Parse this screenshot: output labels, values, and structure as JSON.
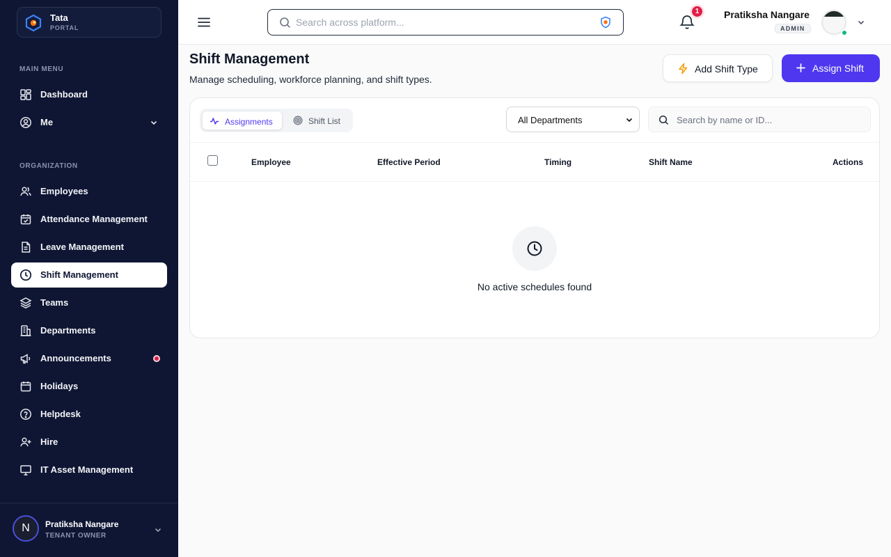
{
  "brand": {
    "name": "Tata",
    "subtitle": "PORTAL"
  },
  "sidebar": {
    "main_menu_label": "MAIN MENU",
    "main_items": [
      {
        "label": "Dashboard",
        "icon": "dashboard-icon"
      },
      {
        "label": "Me",
        "icon": "user-circle-icon",
        "expandable": true
      }
    ],
    "org_label": "ORGANIZATION",
    "org_items": [
      {
        "label": "Employees",
        "icon": "users-icon"
      },
      {
        "label": "Attendance Management",
        "icon": "calendar-check-icon"
      },
      {
        "label": "Leave Management",
        "icon": "document-icon"
      },
      {
        "label": "Shift Management",
        "icon": "clock-icon",
        "active": true
      },
      {
        "label": "Teams",
        "icon": "layers-icon"
      },
      {
        "label": "Departments",
        "icon": "building-icon"
      },
      {
        "label": "Announcements",
        "icon": "megaphone-icon",
        "badge_dot": true
      },
      {
        "label": "Holidays",
        "icon": "calendar-icon"
      },
      {
        "label": "Helpdesk",
        "icon": "help-circle-icon"
      },
      {
        "label": "Hire",
        "icon": "user-plus-icon"
      },
      {
        "label": "IT Asset Management",
        "icon": "monitor-icon"
      }
    ],
    "footer": {
      "initial": "N",
      "name": "Pratiksha Nangare",
      "role": "TENANT OWNER"
    }
  },
  "header": {
    "search_placeholder": "Search across platform...",
    "notification_count": "1",
    "user_name": "Pratiksha Nangare",
    "user_role": "ADMIN"
  },
  "page": {
    "title": "Shift Management",
    "subtitle": "Manage scheduling, workforce planning, and shift types.",
    "add_shift_type_label": "Add Shift Type",
    "assign_shift_label": "Assign Shift"
  },
  "card": {
    "tabs": [
      {
        "label": "Assignments",
        "icon": "activity-icon",
        "active": true
      },
      {
        "label": "Shift List",
        "icon": "target-icon"
      }
    ],
    "department_filter": "All Departments",
    "search_placeholder": "Search by name or ID...",
    "columns": [
      "Employee",
      "Effective Period",
      "Timing",
      "Shift Name",
      "Actions"
    ],
    "empty_message": "No active schedules found"
  },
  "colors": {
    "sidebar_bg": "#0f1634",
    "accent": "#4f37f0",
    "badge": "#e11d48",
    "online": "#10b981"
  }
}
